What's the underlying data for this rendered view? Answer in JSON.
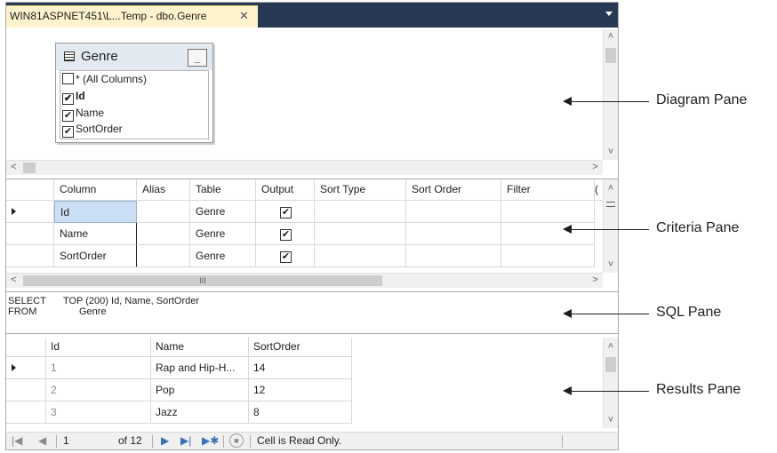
{
  "tab": {
    "title": "WIN81ASPNET451\\L...Temp - dbo.Genre",
    "close": "✕"
  },
  "diagram": {
    "table_name": "Genre",
    "minimize": "_",
    "columns": [
      {
        "label": "* (All Columns)",
        "checked": false,
        "bold": false
      },
      {
        "label": "Id",
        "checked": true,
        "bold": true
      },
      {
        "label": "Name",
        "checked": true,
        "bold": false
      },
      {
        "label": "SortOrder",
        "checked": true,
        "bold": false
      }
    ]
  },
  "criteria": {
    "headers": [
      "Column",
      "Alias",
      "Table",
      "Output",
      "Sort Type",
      "Sort Order",
      "Filter",
      "("
    ],
    "rows": [
      {
        "column": "Id",
        "alias": "",
        "table": "Genre",
        "output": true
      },
      {
        "column": "Name",
        "alias": "",
        "table": "Genre",
        "output": true
      },
      {
        "column": "SortOrder",
        "alias": "",
        "table": "Genre",
        "output": true
      }
    ],
    "hscroll_grip": "III"
  },
  "sql": {
    "line1_kw": "SELECT",
    "line1_rest": "TOP (200) Id, Name, SortOrder",
    "line2_kw": "FROM",
    "line2_rest": "Genre"
  },
  "results": {
    "headers": [
      "Id",
      "Name",
      "SortOrder"
    ],
    "rows": [
      {
        "id": "1",
        "name": "Rap and Hip-H...",
        "sort": "14"
      },
      {
        "id": "2",
        "name": "Pop",
        "sort": "12"
      },
      {
        "id": "3",
        "name": "Jazz",
        "sort": "8"
      }
    ]
  },
  "navigation": {
    "current_page": "1",
    "of_total": "of 12",
    "status": "Cell is Read Only."
  },
  "annotations": {
    "diagram": "Diagram Pane",
    "criteria": "Criteria Pane",
    "sql": "SQL Pane",
    "results": "Results Pane"
  },
  "colors": {
    "tab_active": "#fff3cd",
    "tab_strip": "#293955",
    "selected_cell": "#cce0f5"
  }
}
